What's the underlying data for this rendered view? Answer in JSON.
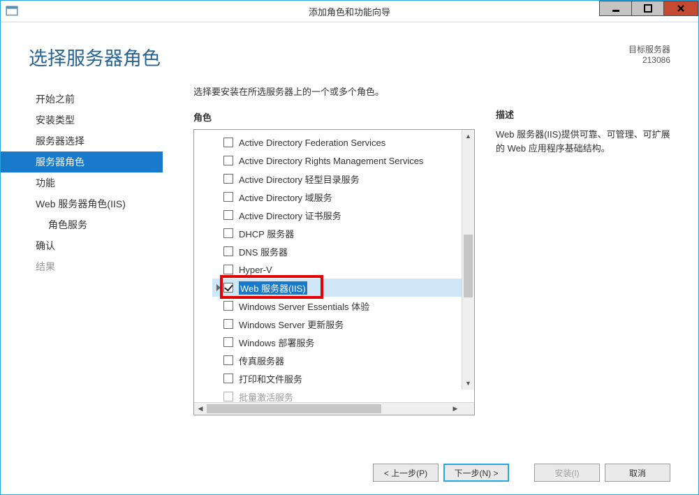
{
  "window": {
    "title": "添加角色和功能向导"
  },
  "header": {
    "page_title": "选择服务器角色",
    "target_label": "目标服务器",
    "target_name": "213086"
  },
  "nav": {
    "items": [
      {
        "label": "开始之前",
        "selected": false,
        "disabled": false,
        "sub": false
      },
      {
        "label": "安装类型",
        "selected": false,
        "disabled": false,
        "sub": false
      },
      {
        "label": "服务器选择",
        "selected": false,
        "disabled": false,
        "sub": false
      },
      {
        "label": "服务器角色",
        "selected": true,
        "disabled": false,
        "sub": false
      },
      {
        "label": "功能",
        "selected": false,
        "disabled": false,
        "sub": false
      },
      {
        "label": "Web 服务器角色(IIS)",
        "selected": false,
        "disabled": false,
        "sub": false
      },
      {
        "label": "角色服务",
        "selected": false,
        "disabled": false,
        "sub": true
      },
      {
        "label": "确认",
        "selected": false,
        "disabled": false,
        "sub": false
      },
      {
        "label": "结果",
        "selected": false,
        "disabled": true,
        "sub": false
      }
    ]
  },
  "main": {
    "prompt": "选择要安装在所选服务器上的一个或多个角色。",
    "roles_label": "角色",
    "roles": [
      {
        "label": "Active Directory Federation Services",
        "checked": false,
        "selected": false
      },
      {
        "label": "Active Directory Rights Management Services",
        "checked": false,
        "selected": false
      },
      {
        "label": "Active Directory 轻型目录服务",
        "checked": false,
        "selected": false
      },
      {
        "label": "Active Directory 域服务",
        "checked": false,
        "selected": false
      },
      {
        "label": "Active Directory 证书服务",
        "checked": false,
        "selected": false
      },
      {
        "label": "DHCP 服务器",
        "checked": false,
        "selected": false
      },
      {
        "label": "DNS 服务器",
        "checked": false,
        "selected": false
      },
      {
        "label": "Hyper-V",
        "checked": false,
        "selected": false
      },
      {
        "label": "Web 服务器(IIS)",
        "checked": true,
        "selected": true,
        "expandable": true
      },
      {
        "label": "Windows Server Essentials 体验",
        "checked": false,
        "selected": false
      },
      {
        "label": "Windows Server 更新服务",
        "checked": false,
        "selected": false
      },
      {
        "label": "Windows 部署服务",
        "checked": false,
        "selected": false
      },
      {
        "label": "传真服务器",
        "checked": false,
        "selected": false
      },
      {
        "label": "打印和文件服务",
        "checked": false,
        "selected": false
      },
      {
        "label": "批量激活服务",
        "checked": false,
        "selected": false
      }
    ],
    "desc_label": "描述",
    "desc_text": "Web 服务器(IIS)提供可靠、可管理、可扩展的 Web 应用程序基础结构。"
  },
  "footer": {
    "prev": "< 上一步(P)",
    "next": "下一步(N) >",
    "install": "安装(I)",
    "cancel": "取消"
  }
}
